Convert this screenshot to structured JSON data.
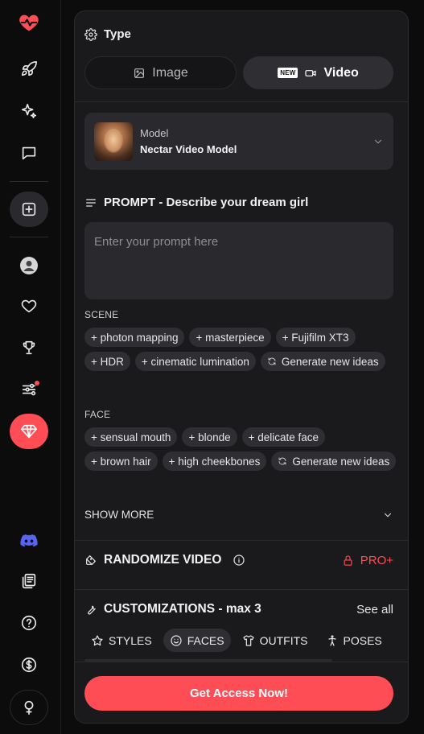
{
  "rail": {
    "items": [
      {
        "icon": "heart-pulse-icon"
      },
      {
        "icon": "rocket-icon"
      },
      {
        "icon": "sparkles-icon"
      },
      {
        "icon": "chat-icon"
      },
      {
        "icon": "add-square-icon"
      },
      {
        "icon": "user-avatar-icon"
      },
      {
        "icon": "heart-icon"
      },
      {
        "icon": "trophy-icon"
      },
      {
        "icon": "sliders-icon"
      },
      {
        "icon": "diamond-icon"
      },
      {
        "icon": "discord-icon"
      },
      {
        "icon": "gallery-icon"
      },
      {
        "icon": "help-icon"
      },
      {
        "icon": "dollar-icon"
      },
      {
        "icon": "lightbulb-icon"
      }
    ],
    "accent": "#ff4d55",
    "discord_color": "#5865f2"
  },
  "type": {
    "title": "Type",
    "image_label": "Image",
    "video_label": "Video",
    "new_badge": "NEW"
  },
  "model": {
    "label": "Model",
    "name": "Nectar Video Model"
  },
  "prompt": {
    "title": "PROMPT - Describe your dream girl",
    "placeholder": "Enter your prompt here"
  },
  "scene": {
    "label": "SCENE",
    "chips": [
      "+ photon mapping",
      "+ masterpiece",
      "+ Fujifilm XT3",
      "+ HDR",
      "+ cinematic lumination"
    ],
    "generate": "Generate new ideas"
  },
  "face": {
    "label": "FACE",
    "chips": [
      "+ sensual mouth",
      "+ blonde",
      "+ delicate face",
      "+ brown hair",
      "+ high cheekbones"
    ],
    "generate": "Generate new ideas"
  },
  "show_more": "SHOW MORE",
  "randomize": {
    "title": "RANDOMIZE VIDEO",
    "pro": "PRO+"
  },
  "customizations": {
    "title": "CUSTOMIZATIONS - max 3",
    "see_all": "See all",
    "tabs": [
      "STYLES",
      "FACES",
      "OUTFITS",
      "POSES"
    ],
    "active_tab": "FACES"
  },
  "cta": "Get Access Now!"
}
